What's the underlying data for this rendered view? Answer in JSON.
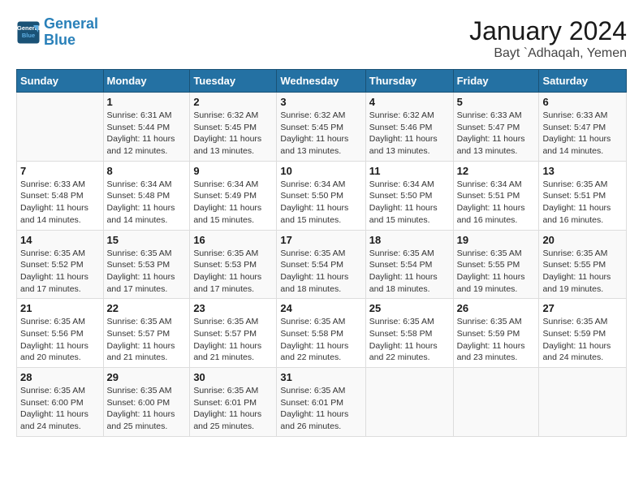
{
  "header": {
    "logo_line1": "General",
    "logo_line2": "Blue",
    "main_title": "January 2024",
    "subtitle": "Bayt `Adhaqah, Yemen"
  },
  "days_of_week": [
    "Sunday",
    "Monday",
    "Tuesday",
    "Wednesday",
    "Thursday",
    "Friday",
    "Saturday"
  ],
  "weeks": [
    [
      {
        "day": "",
        "sunrise": "",
        "sunset": "",
        "daylight": ""
      },
      {
        "day": "1",
        "sunrise": "Sunrise: 6:31 AM",
        "sunset": "Sunset: 5:44 PM",
        "daylight": "Daylight: 11 hours and 12 minutes."
      },
      {
        "day": "2",
        "sunrise": "Sunrise: 6:32 AM",
        "sunset": "Sunset: 5:45 PM",
        "daylight": "Daylight: 11 hours and 13 minutes."
      },
      {
        "day": "3",
        "sunrise": "Sunrise: 6:32 AM",
        "sunset": "Sunset: 5:45 PM",
        "daylight": "Daylight: 11 hours and 13 minutes."
      },
      {
        "day": "4",
        "sunrise": "Sunrise: 6:32 AM",
        "sunset": "Sunset: 5:46 PM",
        "daylight": "Daylight: 11 hours and 13 minutes."
      },
      {
        "day": "5",
        "sunrise": "Sunrise: 6:33 AM",
        "sunset": "Sunset: 5:47 PM",
        "daylight": "Daylight: 11 hours and 13 minutes."
      },
      {
        "day": "6",
        "sunrise": "Sunrise: 6:33 AM",
        "sunset": "Sunset: 5:47 PM",
        "daylight": "Daylight: 11 hours and 14 minutes."
      }
    ],
    [
      {
        "day": "7",
        "sunrise": "Sunrise: 6:33 AM",
        "sunset": "Sunset: 5:48 PM",
        "daylight": "Daylight: 11 hours and 14 minutes."
      },
      {
        "day": "8",
        "sunrise": "Sunrise: 6:34 AM",
        "sunset": "Sunset: 5:48 PM",
        "daylight": "Daylight: 11 hours and 14 minutes."
      },
      {
        "day": "9",
        "sunrise": "Sunrise: 6:34 AM",
        "sunset": "Sunset: 5:49 PM",
        "daylight": "Daylight: 11 hours and 15 minutes."
      },
      {
        "day": "10",
        "sunrise": "Sunrise: 6:34 AM",
        "sunset": "Sunset: 5:50 PM",
        "daylight": "Daylight: 11 hours and 15 minutes."
      },
      {
        "day": "11",
        "sunrise": "Sunrise: 6:34 AM",
        "sunset": "Sunset: 5:50 PM",
        "daylight": "Daylight: 11 hours and 15 minutes."
      },
      {
        "day": "12",
        "sunrise": "Sunrise: 6:34 AM",
        "sunset": "Sunset: 5:51 PM",
        "daylight": "Daylight: 11 hours and 16 minutes."
      },
      {
        "day": "13",
        "sunrise": "Sunrise: 6:35 AM",
        "sunset": "Sunset: 5:51 PM",
        "daylight": "Daylight: 11 hours and 16 minutes."
      }
    ],
    [
      {
        "day": "14",
        "sunrise": "Sunrise: 6:35 AM",
        "sunset": "Sunset: 5:52 PM",
        "daylight": "Daylight: 11 hours and 17 minutes."
      },
      {
        "day": "15",
        "sunrise": "Sunrise: 6:35 AM",
        "sunset": "Sunset: 5:53 PM",
        "daylight": "Daylight: 11 hours and 17 minutes."
      },
      {
        "day": "16",
        "sunrise": "Sunrise: 6:35 AM",
        "sunset": "Sunset: 5:53 PM",
        "daylight": "Daylight: 11 hours and 17 minutes."
      },
      {
        "day": "17",
        "sunrise": "Sunrise: 6:35 AM",
        "sunset": "Sunset: 5:54 PM",
        "daylight": "Daylight: 11 hours and 18 minutes."
      },
      {
        "day": "18",
        "sunrise": "Sunrise: 6:35 AM",
        "sunset": "Sunset: 5:54 PM",
        "daylight": "Daylight: 11 hours and 18 minutes."
      },
      {
        "day": "19",
        "sunrise": "Sunrise: 6:35 AM",
        "sunset": "Sunset: 5:55 PM",
        "daylight": "Daylight: 11 hours and 19 minutes."
      },
      {
        "day": "20",
        "sunrise": "Sunrise: 6:35 AM",
        "sunset": "Sunset: 5:55 PM",
        "daylight": "Daylight: 11 hours and 19 minutes."
      }
    ],
    [
      {
        "day": "21",
        "sunrise": "Sunrise: 6:35 AM",
        "sunset": "Sunset: 5:56 PM",
        "daylight": "Daylight: 11 hours and 20 minutes."
      },
      {
        "day": "22",
        "sunrise": "Sunrise: 6:35 AM",
        "sunset": "Sunset: 5:57 PM",
        "daylight": "Daylight: 11 hours and 21 minutes."
      },
      {
        "day": "23",
        "sunrise": "Sunrise: 6:35 AM",
        "sunset": "Sunset: 5:57 PM",
        "daylight": "Daylight: 11 hours and 21 minutes."
      },
      {
        "day": "24",
        "sunrise": "Sunrise: 6:35 AM",
        "sunset": "Sunset: 5:58 PM",
        "daylight": "Daylight: 11 hours and 22 minutes."
      },
      {
        "day": "25",
        "sunrise": "Sunrise: 6:35 AM",
        "sunset": "Sunset: 5:58 PM",
        "daylight": "Daylight: 11 hours and 22 minutes."
      },
      {
        "day": "26",
        "sunrise": "Sunrise: 6:35 AM",
        "sunset": "Sunset: 5:59 PM",
        "daylight": "Daylight: 11 hours and 23 minutes."
      },
      {
        "day": "27",
        "sunrise": "Sunrise: 6:35 AM",
        "sunset": "Sunset: 5:59 PM",
        "daylight": "Daylight: 11 hours and 24 minutes."
      }
    ],
    [
      {
        "day": "28",
        "sunrise": "Sunrise: 6:35 AM",
        "sunset": "Sunset: 6:00 PM",
        "daylight": "Daylight: 11 hours and 24 minutes."
      },
      {
        "day": "29",
        "sunrise": "Sunrise: 6:35 AM",
        "sunset": "Sunset: 6:00 PM",
        "daylight": "Daylight: 11 hours and 25 minutes."
      },
      {
        "day": "30",
        "sunrise": "Sunrise: 6:35 AM",
        "sunset": "Sunset: 6:01 PM",
        "daylight": "Daylight: 11 hours and 25 minutes."
      },
      {
        "day": "31",
        "sunrise": "Sunrise: 6:35 AM",
        "sunset": "Sunset: 6:01 PM",
        "daylight": "Daylight: 11 hours and 26 minutes."
      },
      {
        "day": "",
        "sunrise": "",
        "sunset": "",
        "daylight": ""
      },
      {
        "day": "",
        "sunrise": "",
        "sunset": "",
        "daylight": ""
      },
      {
        "day": "",
        "sunrise": "",
        "sunset": "",
        "daylight": ""
      }
    ]
  ]
}
